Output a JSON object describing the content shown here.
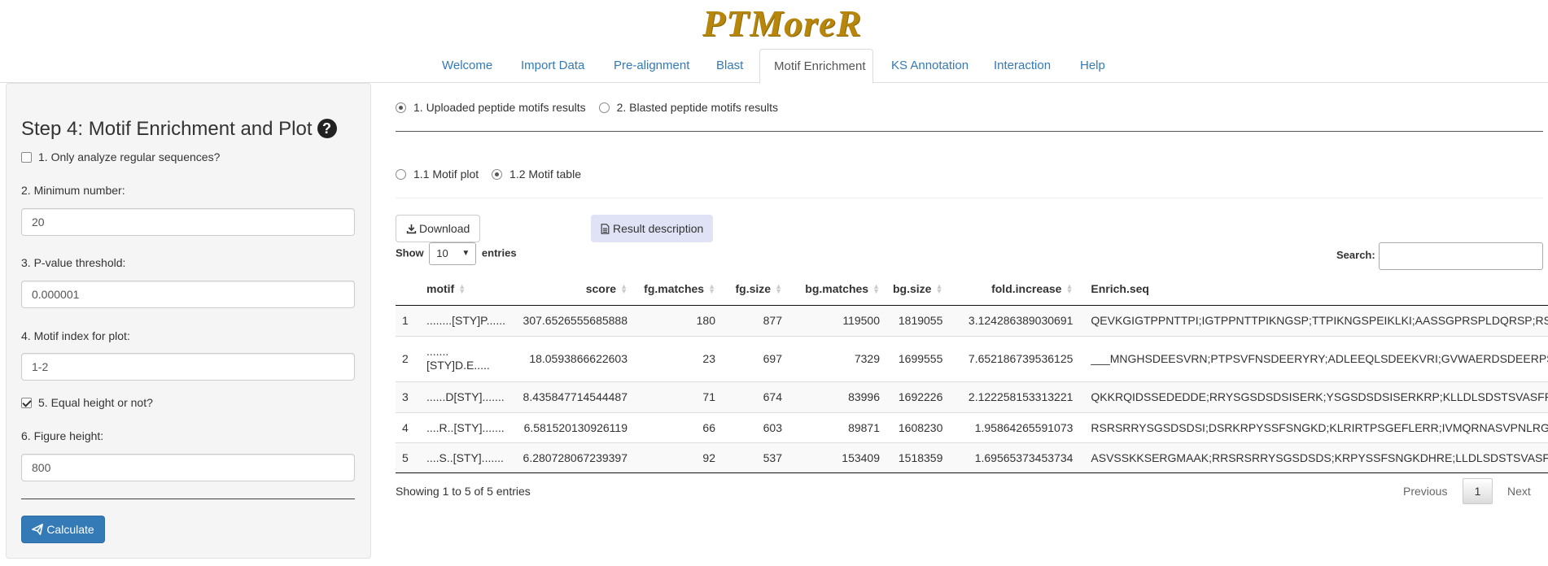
{
  "app": {
    "logo": "PTMoreR"
  },
  "nav": {
    "tabs": [
      "Welcome",
      "Import Data",
      "Pre-alignment",
      "Blast",
      "Motif Enrichment",
      "KS Annotation",
      "Interaction",
      "Help"
    ],
    "active": "Motif Enrichment"
  },
  "sidebar": {
    "title": "Step 4: Motif Enrichment and Plot",
    "help_icon": "question-circle-icon",
    "only_regular_label": "1. Only analyze regular sequences?",
    "only_regular_checked": false,
    "min_number_label": "2. Minimum number:",
    "min_number_value": "20",
    "pvalue_label": "3. P-value threshold:",
    "pvalue_value": "0.000001",
    "motif_index_label": "4. Motif index for plot:",
    "motif_index_value": "1-2",
    "equal_height_label": "5. Equal height or not?",
    "equal_height_checked": true,
    "fig_height_label": "6. Figure height:",
    "fig_height_value": "800",
    "calculate_label": "Calculate",
    "calculate_icon": "paper-plane-icon"
  },
  "main": {
    "results_options": [
      "1. Uploaded peptide motifs results",
      "2. Blasted peptide motifs results"
    ],
    "results_selected": 0,
    "view_options": [
      "1.1 Motif plot",
      "1.2 Motif table"
    ],
    "view_selected": 1,
    "download_label": "Download",
    "download_icon": "download-icon",
    "description_label": "Result description",
    "description_icon": "file-icon",
    "show_label": "Show",
    "entries_value": "10",
    "entries_label": "entries",
    "search_label": "Search:",
    "search_value": "",
    "table": {
      "columns": [
        "",
        "motif",
        "score",
        "fg.matches",
        "fg.size",
        "bg.matches",
        "bg.size",
        "fold.increase",
        "Enrich.seq"
      ],
      "rows": [
        [
          "1",
          "........[STY]P......",
          "307.6526555685888",
          "180",
          "877",
          "119500",
          "1819055",
          "3.124286389030691",
          "QEVKGIGTPPNTTPI;IGTPPNTTPIKNGSP;TTPIKNGSPEIKLKI;AASSGPRSPLDQRSP;RSPLDQRSPSSLPSP;RTSPSLPSPAK"
        ],
        [
          ".......\n[STY]D.E.....",
          "",
          "",
          "",
          "",
          "",
          "",
          "",
          ""
        ],
        [
          "3",
          "......D[STY].......",
          "8.435847714544487",
          "71",
          "674",
          "83996",
          "1692226",
          "2.122258153313221",
          "QKKRQIDSSEDEDDE;RRYSGSDSDSISERK;YSGSDSDSISERKRP;KLLDLSDSTSVASFP;LDSDSTSVASF"
        ],
        [
          "4",
          "....R..[STY].......",
          "6.581520130926119",
          "66",
          "603",
          "89871",
          "1608230",
          "1.95864265591073",
          "RSRSRRYSGSDSDSI;DSRKRPYSSFSNGKD;KLRIRTPSGEFLERR;IVMQRNASVPNLRGS;QRN"
        ],
        [
          "5",
          "....S..[STY].......",
          "6.280728067239397",
          "92",
          "537",
          "153409",
          "1518359",
          "1.69565373453734",
          "ASVSSKKSERGMAAK;RRSRSRRYSGSDSDS;KRPYSSFSNGKDHRE;LLDLSDSTSVASFPA;LSDS"
        ]
      ],
      "row2": {
        "index": "2",
        "motif_line1": ".......",
        "motif_line2": "[STY]D.E.....",
        "score": "18.0593866622603",
        "fg_matches": "23",
        "fg_size": "697",
        "bg_matches": "7329",
        "bg_size": "1699555",
        "fold_increase": "7.652186739536125",
        "enrich_seq": "___MNGHSDEESVRN;PTPSVFNSDEERYRY;ADLEEQLSDEEKVRI;GVWAERDSDEERPSGE"
      }
    },
    "info": "Showing 1 to 5 of 5 entries",
    "pager": {
      "previous": "Previous",
      "page": "1",
      "next": "Next"
    }
  }
}
